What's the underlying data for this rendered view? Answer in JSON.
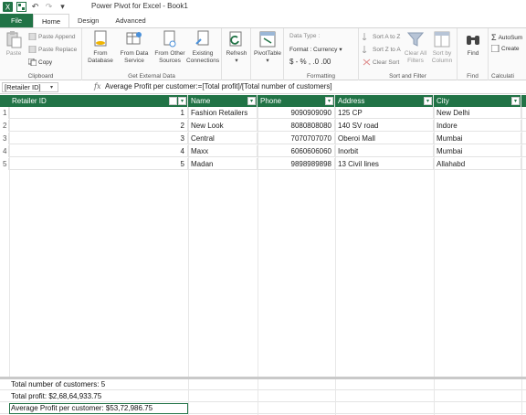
{
  "window": {
    "title": "Power Pivot for Excel - Book1"
  },
  "tabs": [
    {
      "label": "File"
    },
    {
      "label": "Home"
    },
    {
      "label": "Design"
    },
    {
      "label": "Advanced"
    }
  ],
  "ribbon": {
    "clipboard": {
      "label": "Clipboard",
      "paste": "Paste",
      "paste_append": "Paste Append",
      "paste_replace": "Paste Replace",
      "copy": "Copy"
    },
    "external": {
      "label": "Get External Data",
      "from_database": [
        "From",
        "Database"
      ],
      "from_data_service": [
        "From Data",
        "Service"
      ],
      "from_other": [
        "From Other",
        "Sources"
      ],
      "existing": [
        "Existing",
        "Connections"
      ]
    },
    "refresh": "Refresh",
    "pivottable": "PivotTable",
    "formatting": {
      "label": "Formatting",
      "data_type": "Data Type :",
      "format": "Format : Currency",
      "symbols": "$ - % ,  .0 .00"
    },
    "sort": {
      "label": "Sort and Filter",
      "a_to_z": "Sort A to Z",
      "z_to_a": "Sort Z to A",
      "clear_sort": "Clear Sort",
      "clear_filters": [
        "Clear All",
        "Filters"
      ],
      "sort_by": [
        "Sort by",
        "Column"
      ]
    },
    "find": {
      "label": "Find",
      "button": "Find"
    },
    "calculations": {
      "label": "Calculati",
      "autosum": "AutoSum",
      "create": "Create"
    }
  },
  "formula_bar": {
    "name_box": "[Retailer ID]",
    "fx": "fx",
    "formula": "Average Profit per customer:=[Total profit]/[Total number of customers]"
  },
  "table": {
    "headers": [
      "Retailer ID",
      "Name",
      "Phone",
      "Address",
      "City"
    ],
    "rows": [
      {
        "n": "1",
        "id": "1",
        "name": "Fashion Retailers",
        "phone": "9090909090",
        "address": "125 CP",
        "city": "New Delhi"
      },
      {
        "n": "2",
        "id": "2",
        "name": "New Look",
        "phone": "8080808080",
        "address": "140 SV road",
        "city": "Indore"
      },
      {
        "n": "3",
        "id": "3",
        "name": "Central",
        "phone": "7070707070",
        "address": "Oberoi Mall",
        "city": "Mumbai"
      },
      {
        "n": "4",
        "id": "4",
        "name": "Maxx",
        "phone": "6060606060",
        "address": "Inorbit",
        "city": "Mumbai"
      },
      {
        "n": "5",
        "id": "5",
        "name": "Madan",
        "phone": "9898989898",
        "address": "13 Civil lines",
        "city": "Allahabd"
      }
    ]
  },
  "measures": [
    "Total number of customers: 5",
    "Total profit: $2,68,64,933.75",
    "Average Profit per customer: $53,72,986.75"
  ],
  "colors": {
    "accent": "#217346"
  }
}
